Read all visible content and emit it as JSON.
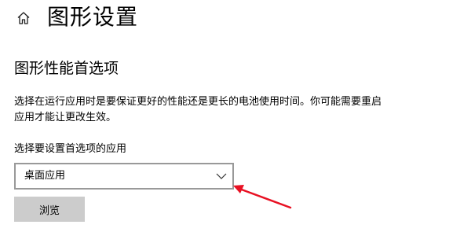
{
  "header": {
    "home_icon": "home-icon",
    "title": "图形设置"
  },
  "main": {
    "section_title": "图形性能首选项",
    "description": "选择在运行应用时是要保证更好的性能还是更长的电池使用时间。你可能需要重启应用才能让更改生效。",
    "app_type_label": "选择要设置首选项的应用",
    "app_type_dropdown": {
      "selected": "桌面应用",
      "icon": "chevron-down-icon"
    },
    "browse_button": "浏览"
  },
  "annotation": {
    "color": "#e81123",
    "type": "red-arrow"
  }
}
